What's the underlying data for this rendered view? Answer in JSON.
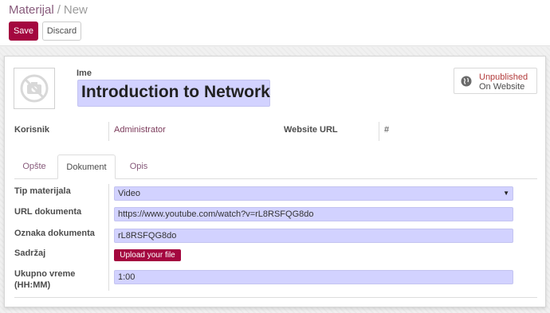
{
  "breadcrumb": {
    "parent": "Materijal",
    "separator": "/",
    "current": "New"
  },
  "toolbar": {
    "save_label": "Save",
    "discard_label": "Discard"
  },
  "record": {
    "name_label": "Ime",
    "name_value": "Introduction to Network",
    "publish": {
      "status": "Unpublished",
      "location": "On Website",
      "icon": "globe-icon"
    },
    "korisnik_label": "Korisnik",
    "korisnik_value": "Administrator",
    "website_url_label": "Website URL",
    "website_url_value": "#"
  },
  "tabs": [
    {
      "label": "Opšte",
      "active": false
    },
    {
      "label": "Dokument",
      "active": true
    },
    {
      "label": "Opis",
      "active": false
    }
  ],
  "document": {
    "tip_label": "Tip materijala",
    "tip_value": "Video",
    "url_label": "URL dokumenta",
    "url_value": "https://www.youtube.com/watch?v=rL8RSFQG8do",
    "oznaka_label": "Oznaka dokumenta",
    "oznaka_value": "rL8RSFQG8do",
    "sadrzaj_label": "Sadržaj",
    "upload_label": "Upload your file",
    "vreme_label_line1": "Ukupno vreme",
    "vreme_label_line2": "(HH:MM)",
    "vreme_value": "1:00"
  },
  "colors": {
    "brand": "#875a7b",
    "primary_button": "#a4073f",
    "required_field": "#d2d2ff",
    "unpublished": "#b23b3b"
  }
}
